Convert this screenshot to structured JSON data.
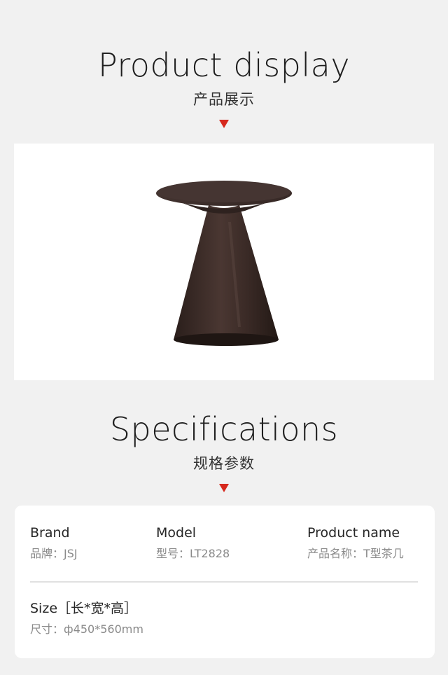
{
  "display_section": {
    "title_en": "Product display",
    "title_cn": "产品展示"
  },
  "product_image": {
    "subject": "side-table",
    "colors": {
      "body": "#3a2a26",
      "highlight": "#5a4640",
      "background": "#ffffff"
    }
  },
  "specs_section": {
    "title_en": "Specifications",
    "title_cn": "规格参数"
  },
  "specs": {
    "brand": {
      "label": "Brand",
      "value": "品牌：JSJ"
    },
    "model": {
      "label": "Model",
      "value": "型号：LT2828"
    },
    "product_name": {
      "label": "Product name",
      "value": "产品名称：T型茶几"
    },
    "size": {
      "label": "Size［长*宽*高］",
      "value": "尺寸：ф450*560mm"
    }
  },
  "colors": {
    "page_background": "#f1f1f1",
    "accent_arrow": "#d6281d",
    "card_background": "#ffffff",
    "value_text": "#8a8a8a"
  }
}
